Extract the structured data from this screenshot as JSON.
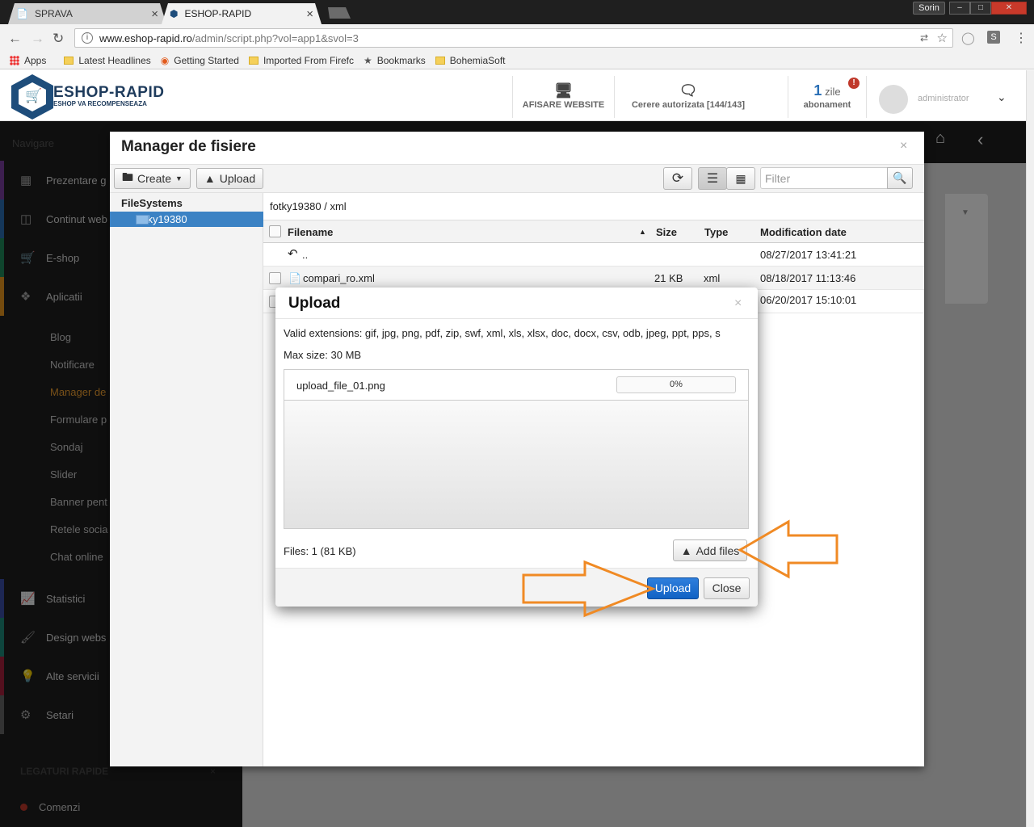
{
  "browser": {
    "tabs": [
      {
        "label": "SPRAVA"
      },
      {
        "label": "ESHOP-RAPID"
      }
    ],
    "profile": "Sorin",
    "url_domain": "www.eshop-rapid.ro",
    "url_path": "/admin/script.php?vol=app1&svol=3",
    "bookmarks": [
      "Apps",
      "Latest Headlines",
      "Getting Started",
      "Imported From Firefc",
      "Bookmarks",
      "BohemiaSoft"
    ]
  },
  "header": {
    "brand": "ESHOP-RAPID",
    "brand_sub": "ESHOP VA RECOMPENSEAZA",
    "afisare": "AFISARE WEBSITE",
    "cerere": "Cerere autorizata [144/143]",
    "zile_num": "1",
    "zile_label": "zile",
    "abonament": "abonament",
    "alert": "!",
    "admin": "administrator"
  },
  "sidebar": {
    "nav_label": "Navigare",
    "items": [
      {
        "label": "Prezentare g",
        "color": "#7b3fa0"
      },
      {
        "label": "Continut web",
        "color": "#2a6fb5"
      },
      {
        "label": "E-shop",
        "color": "#1f8a5a"
      },
      {
        "label": "Aplicatii",
        "color": "#e8961c"
      },
      {
        "label": "Statistici",
        "color": "#3a4fa8"
      },
      {
        "label": "Design webs",
        "color": "#1d8a7a"
      },
      {
        "label": "Alte servicii",
        "color": "#a8203c"
      },
      {
        "label": "Setari",
        "color": "#666666"
      }
    ],
    "subitems": [
      "Blog",
      "Notificare",
      "Manager de",
      "Formulare p",
      "Sondaj",
      "Slider",
      "Banner pent",
      "Retele socia",
      "Chat online"
    ],
    "legaturi": "LEGATURI RAPIDE",
    "comenzi": "Comenzi"
  },
  "file_manager": {
    "title": "Manager de fisiere",
    "create_label": "Create",
    "upload_label": "Upload",
    "filter_placeholder": "Filter",
    "filesystems_label": "FileSystems",
    "folder": "fotky19380",
    "path": "fotky19380 / xml",
    "columns": {
      "filename": "Filename",
      "size": "Size",
      "type": "Type",
      "modified": "Modification date"
    },
    "rows": [
      {
        "name": "..",
        "size": "",
        "type": "",
        "modified": "08/27/2017 13:41:21"
      },
      {
        "name": "compari_ro.xml",
        "size": "21 KB",
        "type": "xml",
        "modified": "08/18/2017 11:13:46"
      },
      {
        "name": "",
        "size": "",
        "type": "",
        "modified": "06/20/2017 15:10:01"
      }
    ]
  },
  "upload_dialog": {
    "title": "Upload",
    "valid_extensions": "Valid extensions: gif, jpg, png, pdf, zip, swf, xml, xls, xlsx, doc, docx, csv, odb, jpeg, ppt, pps, s",
    "max_size": "Max size: 30 MB",
    "file_name": "upload_file_01.png",
    "progress": "0%",
    "files_count": "Files: 1 (81 KB)",
    "add_files_label": "Add files",
    "upload_label": "Upload",
    "close_label": "Close",
    "accent_color": "#1a6fd6",
    "arrow_color": "#f08a24"
  }
}
